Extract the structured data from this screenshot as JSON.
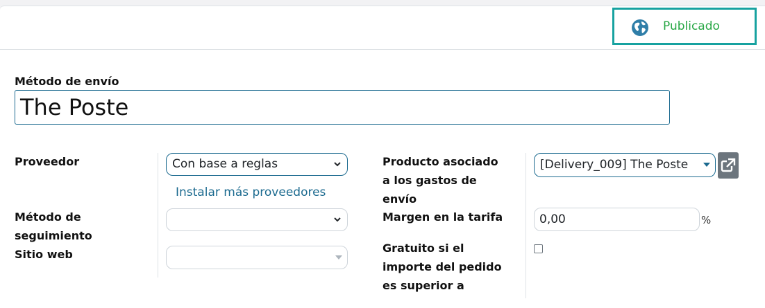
{
  "header": {
    "publish_label": "Publicado"
  },
  "form": {
    "name_label": "Método de envío",
    "name_value": "The Poste",
    "provider_label": "Proveedor",
    "provider_value": "Con base a reglas",
    "install_link": "Instalar más proveedores",
    "tracking_label_line1": "Método de",
    "tracking_label_line2": "seguimiento",
    "tracking_value": "",
    "website_label": "Sitio web",
    "website_value": "",
    "product_label_line1": "Producto asociado",
    "product_label_line2": "a los gastos de",
    "product_label_line3": "envío",
    "product_value": "[Delivery_009] The Poste",
    "margin_label": "Margen en la tarifa",
    "margin_value": "0,00",
    "margin_unit": "%",
    "free_label_line1": "Gratuito si el",
    "free_label_line2": "importe del pedido",
    "free_label_line3": "es superior a"
  },
  "icons": {
    "publish": "globe-icon",
    "external": "external-link-icon",
    "dropdown": "chevron-down-icon"
  },
  "colors": {
    "accent": "#1b6a8f",
    "published": "#28a745",
    "highlight": "#17a2a0"
  }
}
